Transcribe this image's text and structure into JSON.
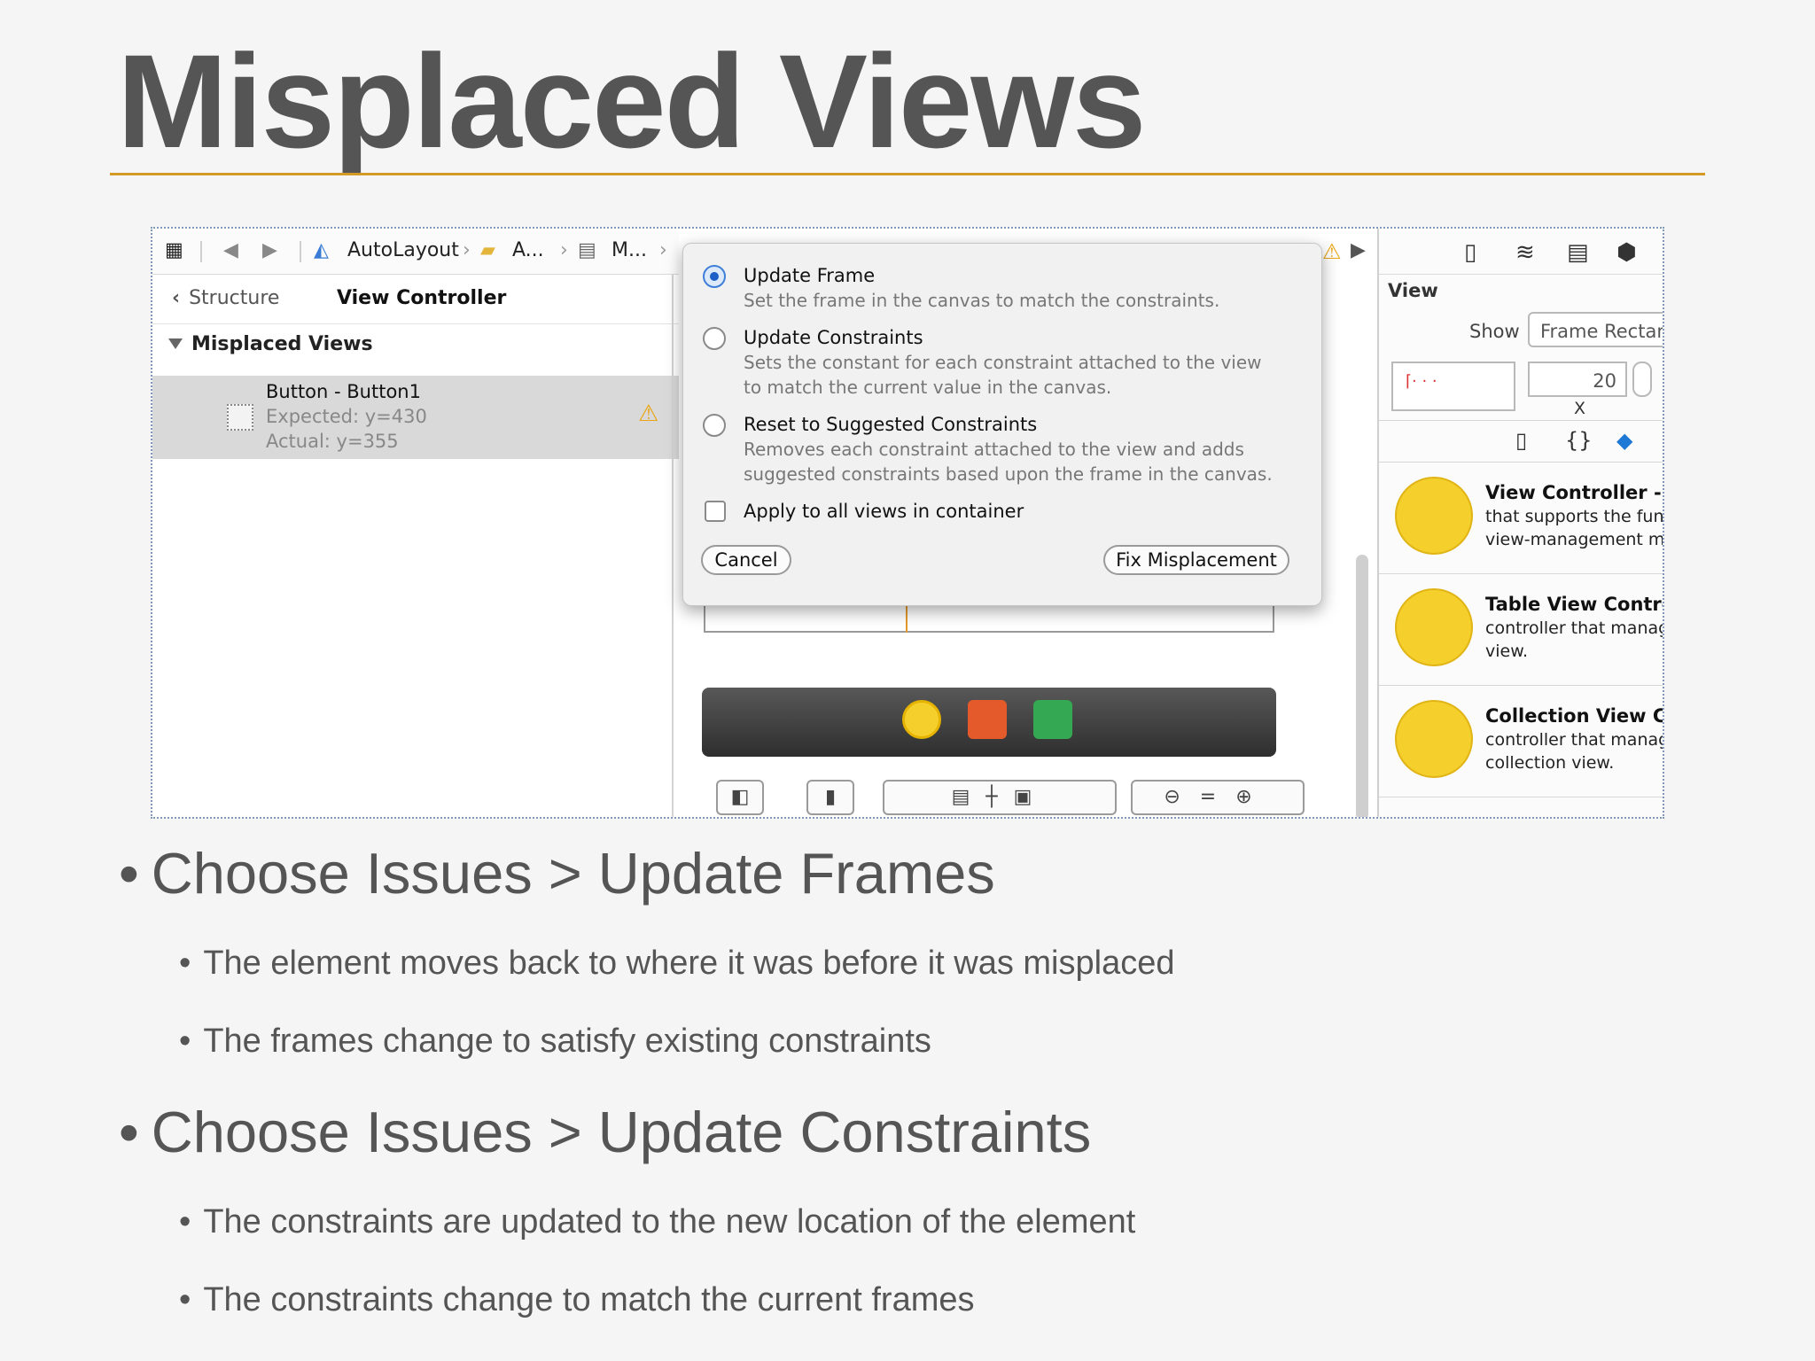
{
  "slide": {
    "title": "Misplaced Views",
    "accent_color": "#d39a25"
  },
  "toolbar": {
    "grid_icon": "grid-icon",
    "breadcrumbs": [
      "AutoLayout",
      "A...",
      "M..."
    ]
  },
  "navigator": {
    "back_label": "Structure",
    "title": "View Controller",
    "section": "Misplaced Views",
    "issue": {
      "name": "Button - Button1",
      "expected": "Expected: y=430",
      "actual": "Actual: y=355"
    }
  },
  "popover": {
    "options": [
      {
        "title": "Update Frame",
        "desc": [
          "Set the frame in the canvas to match the constraints."
        ],
        "selected": true
      },
      {
        "title": "Update Constraints",
        "desc": [
          "Sets the constant for each constraint attached to the view",
          "to match the current value in the canvas."
        ],
        "selected": false
      },
      {
        "title": "Reset to Suggested Constraints",
        "desc": [
          "Removes each constraint attached to the view and adds",
          "suggested constraints based upon the frame in the canvas."
        ],
        "selected": false
      }
    ],
    "checkbox_label": "Apply to all views in container",
    "cancel_label": "Cancel",
    "fix_label": "Fix Misplacement"
  },
  "inspector": {
    "section_label": "View",
    "show_label": "Show",
    "show_value": "Frame Rectan",
    "x_value": "20",
    "x_label": "X",
    "library": [
      {
        "title": "View Controller - A",
        "desc": [
          "that supports the fun",
          "view-management m"
        ]
      },
      {
        "title": "Table View Contro",
        "desc": [
          "controller that manag",
          "view."
        ]
      },
      {
        "title": "Collection View Co",
        "desc": [
          "controller that manag",
          "collection view."
        ]
      }
    ]
  },
  "bullets": [
    {
      "text": "Choose Issues > Update Frames",
      "sub": [
        "The element moves back to where it was before it was misplaced",
        "The frames change to satisfy existing constraints"
      ]
    },
    {
      "text": "Choose Issues > Update Constraints",
      "sub": [
        "The constraints are updated to the new location of the element",
        "The constraints change to match the current frames"
      ]
    }
  ]
}
